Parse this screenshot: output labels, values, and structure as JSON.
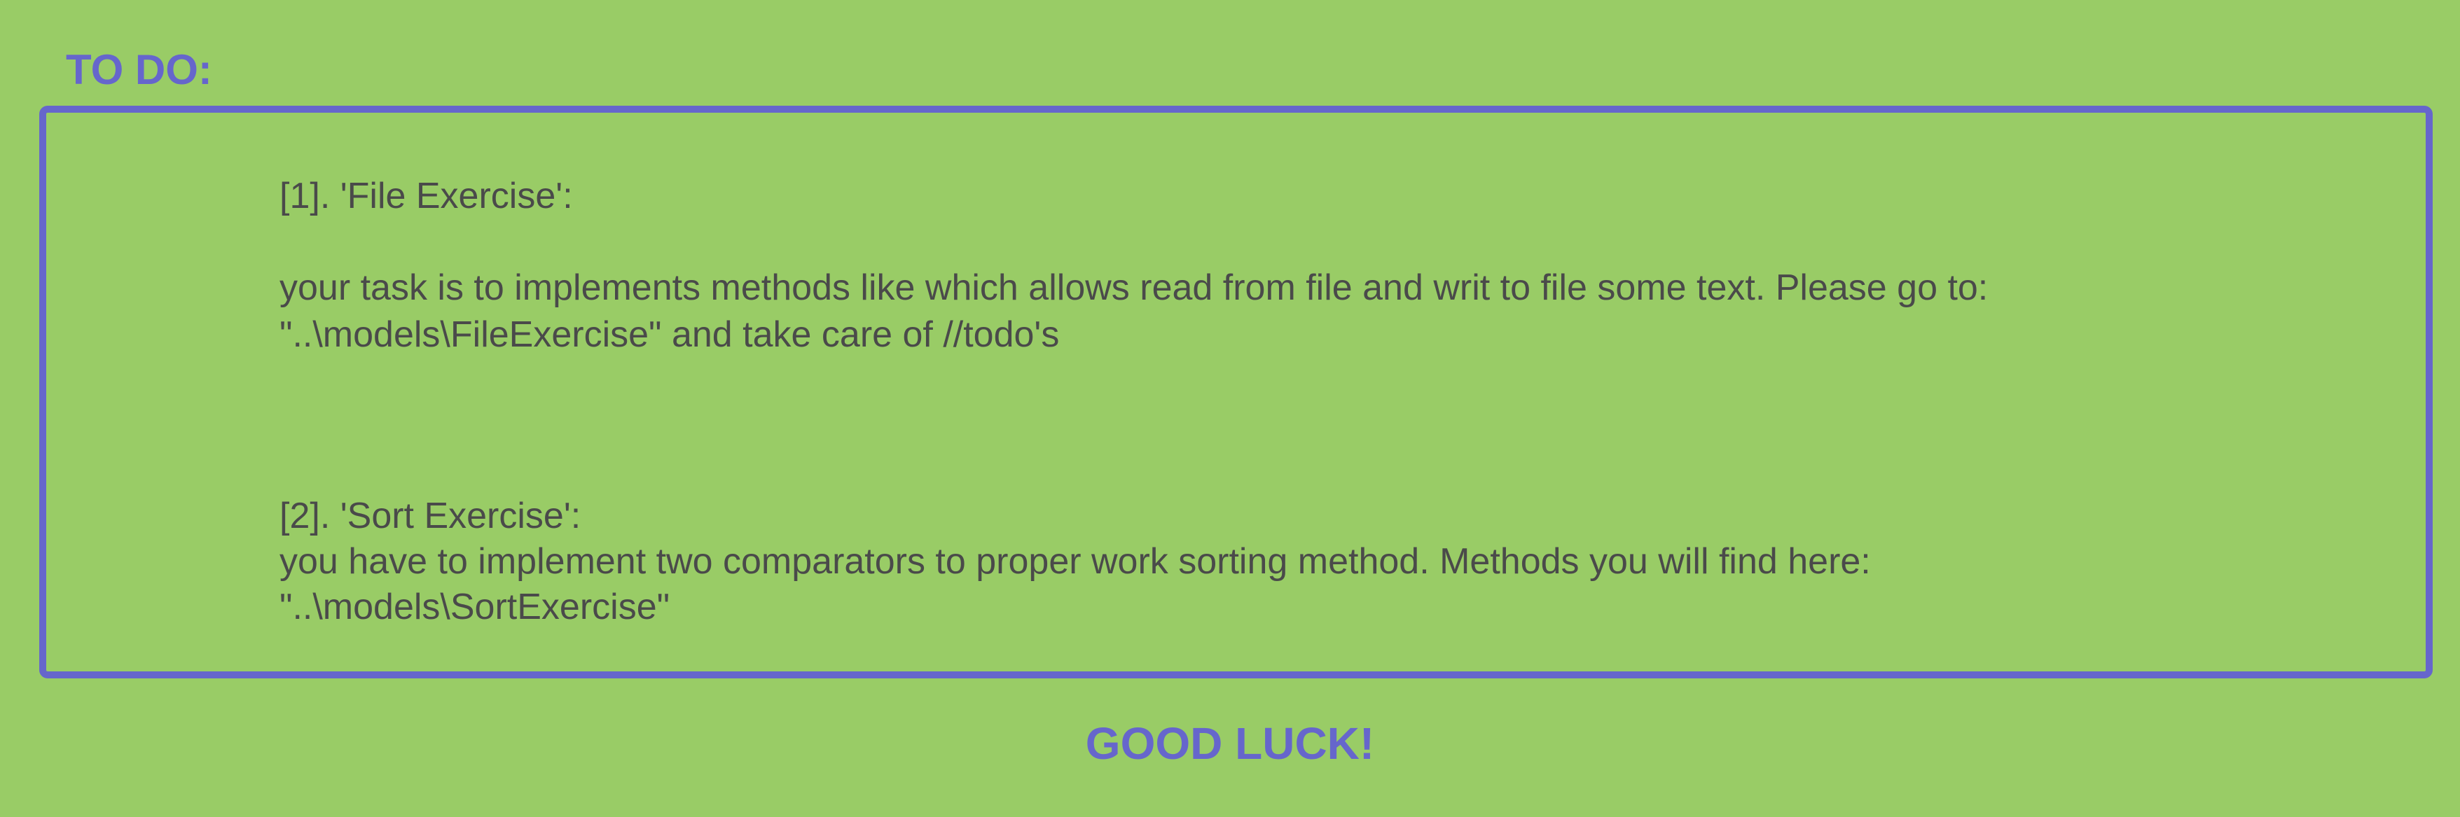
{
  "heading": "TO DO:",
  "tasks": [
    {
      "title": "[1]. 'File Exercise':",
      "description_lines": [
        "your task is to implements methods like which allows read from file and writ to file some text. Please go to:",
        "\"..\\models\\FileExercise\" and take care of //todo's"
      ]
    },
    {
      "title": "[2]. 'Sort Exercise':",
      "description_lines": [
        "you have to implement two comparators to proper work sorting method. Methods you will find here:",
        "\"..\\models\\SortExercise\""
      ]
    }
  ],
  "footer": "GOOD LUCK!",
  "colors": {
    "background": "#99cc66",
    "accent": "#6666cc",
    "text": "#4a4a4a"
  }
}
